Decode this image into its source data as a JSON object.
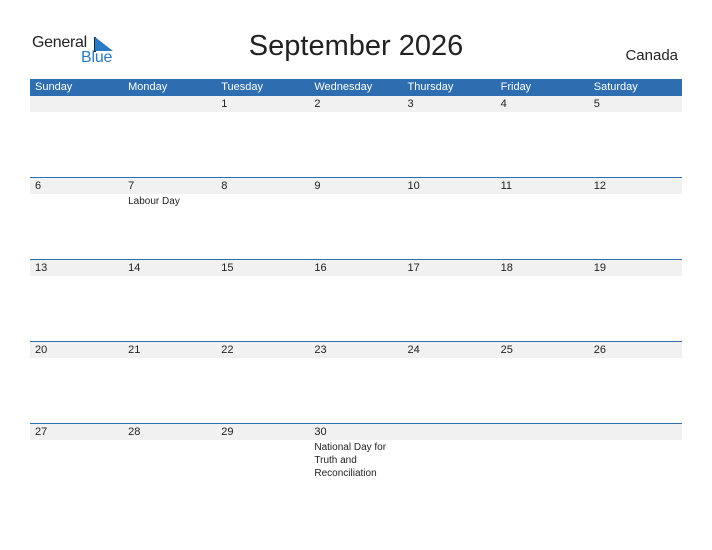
{
  "logo": {
    "line1": "General",
    "line2": "Blue"
  },
  "title": "September 2026",
  "country": "Canada",
  "colors": {
    "header": "#2e6eb0",
    "band": "#f1f1f1",
    "logo_blue": "#2a7bc4"
  },
  "weekdays": [
    "Sunday",
    "Monday",
    "Tuesday",
    "Wednesday",
    "Thursday",
    "Friday",
    "Saturday"
  ],
  "weeks": [
    [
      {
        "d": ""
      },
      {
        "d": ""
      },
      {
        "d": "1"
      },
      {
        "d": "2"
      },
      {
        "d": "3"
      },
      {
        "d": "4"
      },
      {
        "d": "5"
      }
    ],
    [
      {
        "d": "6"
      },
      {
        "d": "7",
        "ev": "Labour Day"
      },
      {
        "d": "8"
      },
      {
        "d": "9"
      },
      {
        "d": "10"
      },
      {
        "d": "11"
      },
      {
        "d": "12"
      }
    ],
    [
      {
        "d": "13"
      },
      {
        "d": "14"
      },
      {
        "d": "15"
      },
      {
        "d": "16"
      },
      {
        "d": "17"
      },
      {
        "d": "18"
      },
      {
        "d": "19"
      }
    ],
    [
      {
        "d": "20"
      },
      {
        "d": "21"
      },
      {
        "d": "22"
      },
      {
        "d": "23"
      },
      {
        "d": "24"
      },
      {
        "d": "25"
      },
      {
        "d": "26"
      }
    ],
    [
      {
        "d": "27"
      },
      {
        "d": "28"
      },
      {
        "d": "29"
      },
      {
        "d": "30",
        "ev": "National Day for Truth and Reconciliation"
      },
      {
        "d": ""
      },
      {
        "d": ""
      },
      {
        "d": ""
      }
    ]
  ]
}
